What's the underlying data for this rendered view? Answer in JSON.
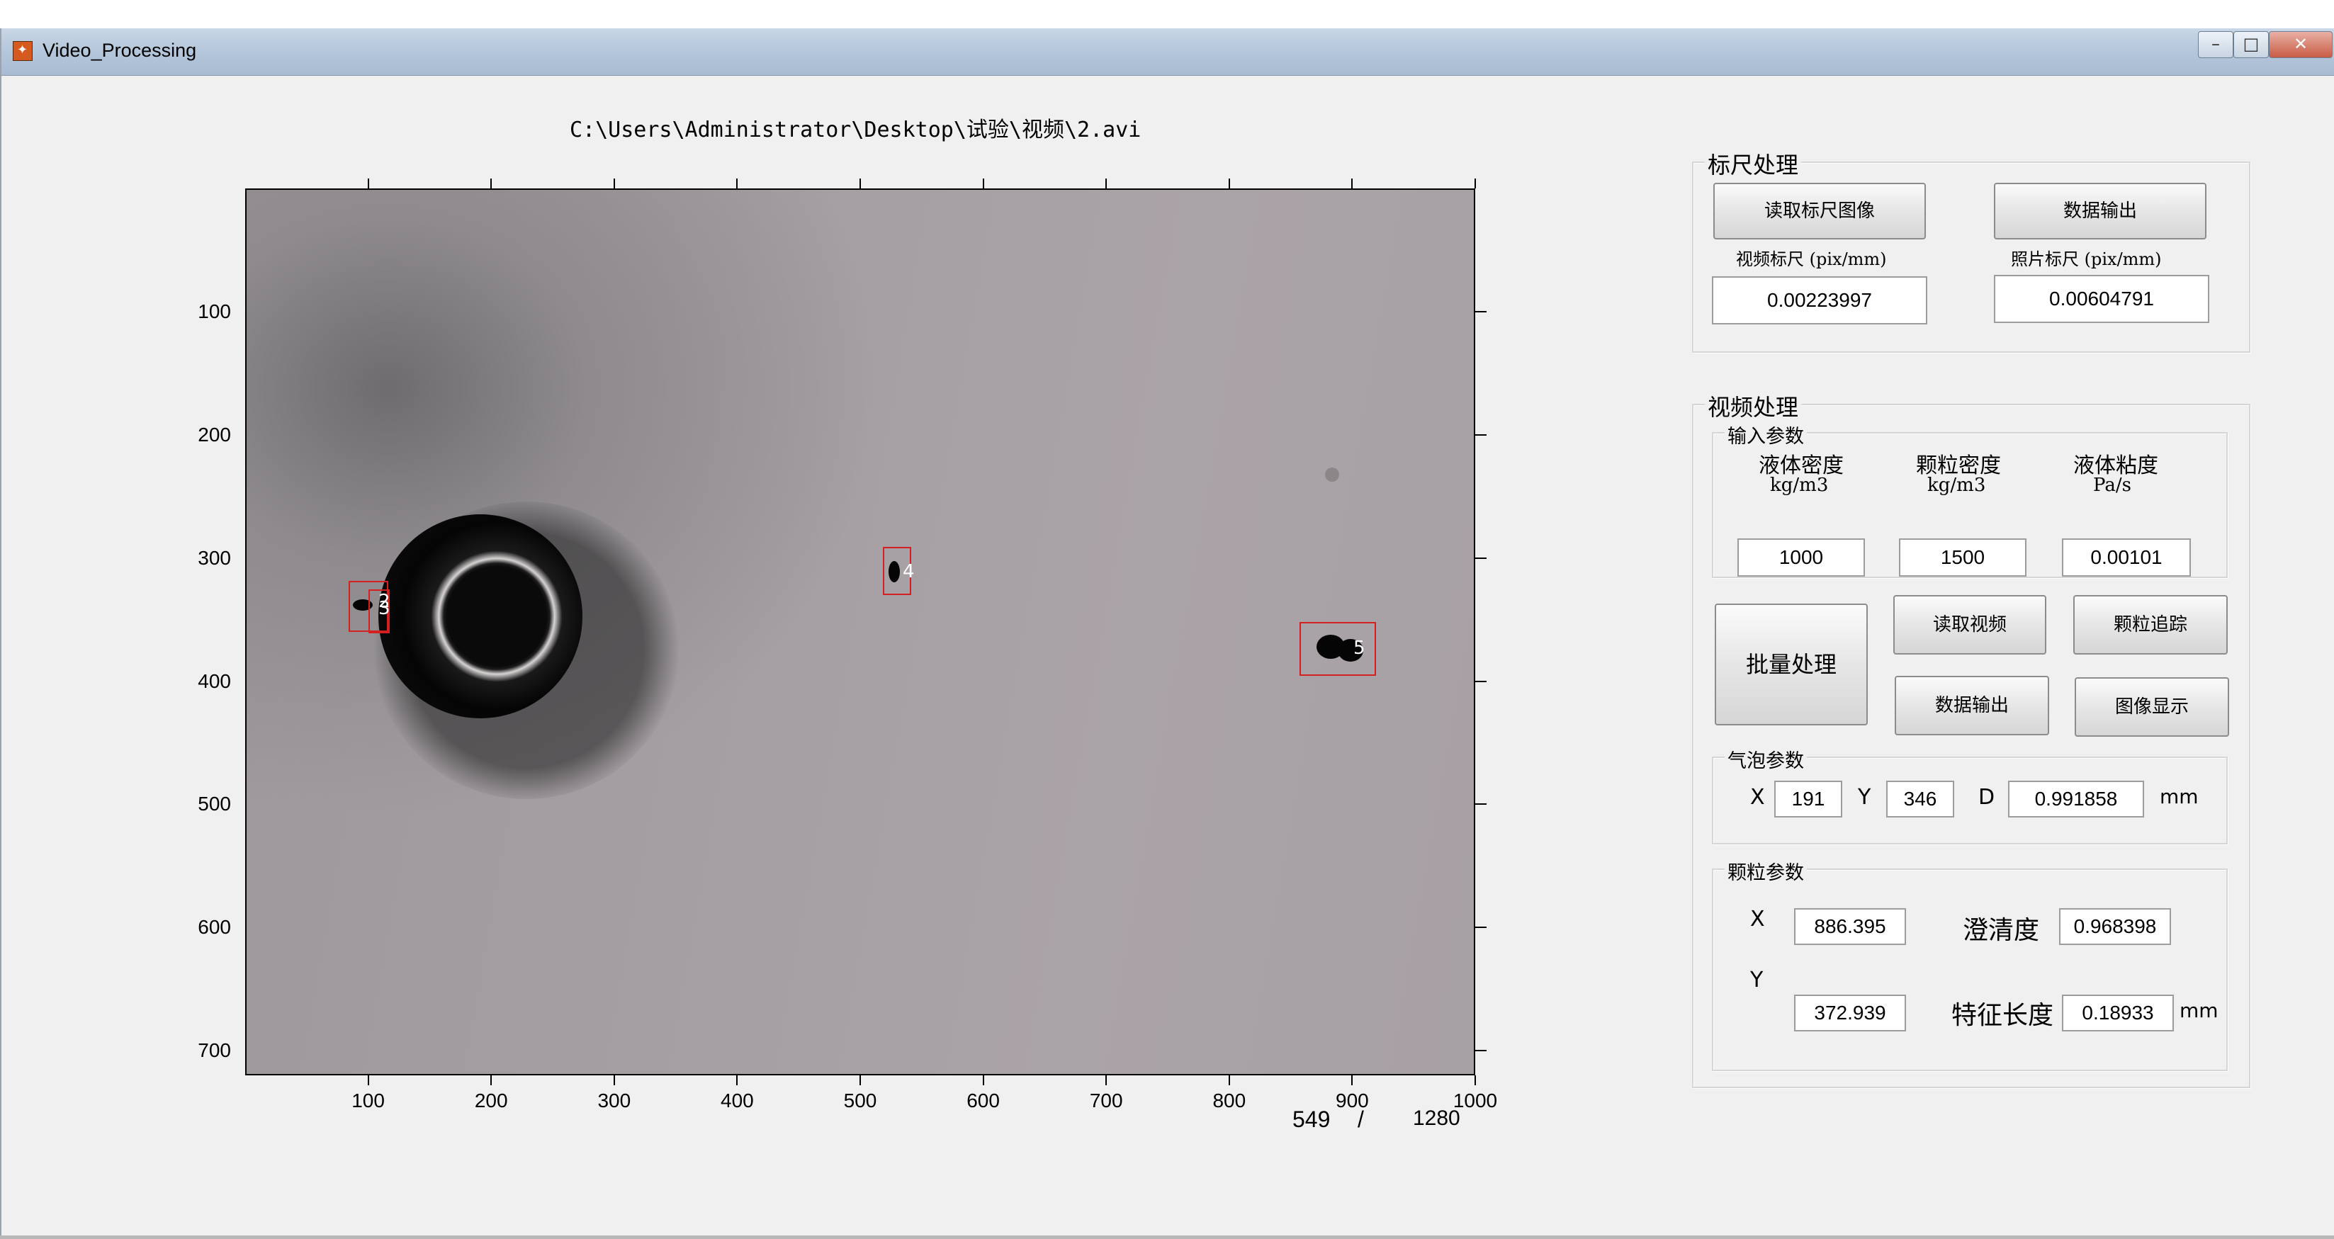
{
  "window": {
    "title": "Video_Processing"
  },
  "file_path": "C:\\Users\\Administrator\\Desktop\\试验\\视频\\2.avi",
  "axes": {
    "x_ticks": [
      "100",
      "200",
      "300",
      "400",
      "500",
      "600",
      "700",
      "800",
      "900",
      "1000"
    ],
    "y_ticks": [
      "100",
      "200",
      "300",
      "400",
      "500",
      "600",
      "700"
    ],
    "xlim": [
      0,
      1000
    ],
    "ylim": [
      0,
      720
    ]
  },
  "frame_counter": {
    "current": "549",
    "separator": "/",
    "total": "1280"
  },
  "particles": [
    {
      "label": "2",
      "x": 105,
      "y": 345
    },
    {
      "label": "3",
      "x": 108,
      "y": 343
    },
    {
      "label": "4",
      "x": 530,
      "y": 310
    },
    {
      "label": "5",
      "x": 886,
      "y": 373
    }
  ],
  "scale_panel": {
    "title": "标尺处理",
    "read_button": "读取标尺图像",
    "export_button": "数据输出",
    "video_scale_label": "视频标尺 (pix/mm)",
    "photo_scale_label": "照片标尺 (pix/mm)",
    "video_scale_value": "0.00223997",
    "photo_scale_value": "0.00604791"
  },
  "video_panel": {
    "title": "视频处理",
    "inputs": {
      "title": "输入参数",
      "liquid_density_label": "液体密度",
      "liquid_density_unit": "kg/m3",
      "particle_density_label": "颗粒密度",
      "particle_density_unit": "kg/m3",
      "viscosity_label": "液体粘度",
      "viscosity_unit": "Pa/s",
      "liquid_density_value": "1000",
      "particle_density_value": "1500",
      "viscosity_value": "0.00101"
    },
    "batch_button": "批量处理",
    "read_video_button": "读取视频",
    "track_button": "颗粒追踪",
    "export_button": "数据输出",
    "display_button": "图像显示",
    "bubble": {
      "title": "气泡参数",
      "x_label": "X",
      "x_value": "191",
      "y_label": "Y",
      "y_value": "346",
      "d_label": "D",
      "d_value": "0.991858",
      "unit": "mm"
    },
    "particle": {
      "title": "颗粒参数",
      "x_label": "X",
      "x_value": "886.395",
      "y_label": "Y",
      "y_value": "372.939",
      "clarity_label": "澄清度",
      "clarity_value": "0.968398",
      "length_label": "特征长度",
      "length_value": "0.18933",
      "unit": "mm"
    }
  }
}
